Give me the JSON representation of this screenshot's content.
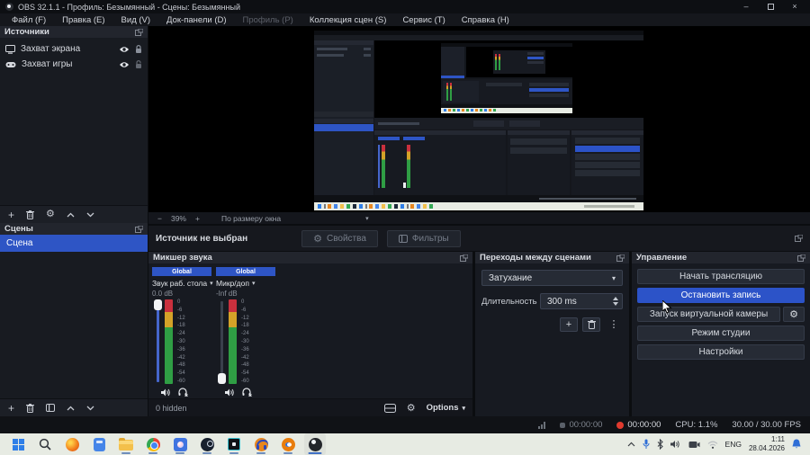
{
  "window": {
    "title": "OBS 32.1.1 - Профиль: Безымянный - Сцены: Безымянный"
  },
  "icons": {
    "minimize": "–",
    "close": "×",
    "gear": "⚙",
    "gears": "⚙",
    "plus": "+",
    "minus": "−",
    "kebab": "⋮",
    "caret": "▾",
    "caret_small": "▾"
  },
  "menu": {
    "items": [
      {
        "label": "Файл (F)"
      },
      {
        "label": "Правка (E)"
      },
      {
        "label": "Вид (V)"
      },
      {
        "label": "Док-панели (D)"
      },
      {
        "label": "Профиль (P)"
      },
      {
        "label": "Коллекция сцен (S)"
      },
      {
        "label": "Сервис (T)"
      },
      {
        "label": "Справка (H)"
      }
    ]
  },
  "sources": {
    "title": "Источники",
    "items": [
      {
        "label": "Захват экрана",
        "icon": "monitor"
      },
      {
        "label": "Захват игры",
        "icon": "gamepad"
      }
    ]
  },
  "scenes": {
    "title": "Сцены",
    "items": [
      {
        "label": "Сцена",
        "selected": true
      }
    ]
  },
  "preview": {
    "zoom_level": "39%",
    "fit_mode": "По размеру окна",
    "no_source": "Источник не выбран",
    "properties": "Свойства",
    "filters": "Фильтры"
  },
  "mixer": {
    "title": "Микшер звука",
    "channels": [
      {
        "badge": "Global",
        "name": "Звук раб. стола",
        "volume": "0.0 dB"
      },
      {
        "badge": "Global",
        "name": "Микр/доп",
        "volume": "-Inf dB"
      }
    ],
    "ticks": [
      "0",
      "-6",
      "-12",
      "-18",
      "-24",
      "-30",
      "-36",
      "-42",
      "-48",
      "-54",
      "-60"
    ],
    "hidden_count": "0 hidden",
    "options": "Options"
  },
  "transitions": {
    "title": "Переходы между сценами",
    "current": "Затухание",
    "duration_label": "Длительность",
    "duration": "300 ms"
  },
  "controls": {
    "title": "Управление",
    "start_stream": "Начать трансляцию",
    "stop_record": "Остановить запись",
    "virtual_cam": "Запуск виртуальной камеры",
    "studio_mode": "Режим студии",
    "settings": "Настройки"
  },
  "status": {
    "stream_time": "00:00:00",
    "record_time": "00:00:00",
    "cpu": "CPU: 1.1%",
    "fps": "30.00 / 30.00 FPS"
  },
  "taskbar": {
    "apps": [
      "start",
      "search",
      "firefox",
      "calculator",
      "explorer",
      "chrome",
      "photos",
      "steam",
      "dev-tool",
      "audio-app",
      "blender",
      "obs"
    ],
    "language": "ENG",
    "time": "1:11",
    "date": "28.04.2026"
  },
  "colors": {
    "accent": "#2e55c5",
    "record_red": "#e03a2e",
    "meter_red": "#c9303d",
    "meter_yellow": "#d4a228",
    "meter_green": "#2f9e44"
  }
}
